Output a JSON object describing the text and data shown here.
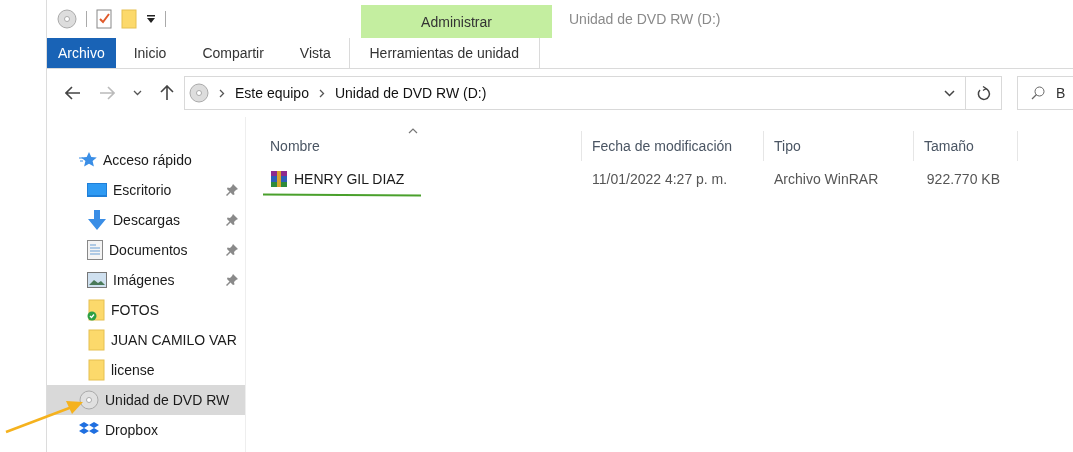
{
  "window": {
    "title": "Unidad de DVD RW (D:)"
  },
  "ribbon": {
    "context_group": "Administrar",
    "tabs": [
      {
        "label": "Archivo",
        "kind": "file"
      },
      {
        "label": "Inicio",
        "kind": "normal"
      },
      {
        "label": "Compartir",
        "kind": "normal"
      },
      {
        "label": "Vista",
        "kind": "normal"
      },
      {
        "label": "Herramientas de unidad",
        "kind": "context"
      }
    ]
  },
  "address_bar": {
    "crumbs": [
      "Este equipo",
      "Unidad de DVD RW (D:)"
    ]
  },
  "search": {
    "placeholder": "B"
  },
  "navigation": [
    {
      "label": "Acceso rápido",
      "kind": "star",
      "pinned": false,
      "selected": false,
      "children": [
        {
          "label": "Escritorio",
          "kind": "desktop",
          "pinned": true,
          "selected": false
        },
        {
          "label": "Descargas",
          "kind": "download",
          "pinned": true,
          "selected": false
        },
        {
          "label": "Documentos",
          "kind": "document",
          "pinned": true,
          "selected": false
        },
        {
          "label": "Imágenes",
          "kind": "images",
          "pinned": true,
          "selected": false
        },
        {
          "label": "FOTOS",
          "kind": "synced",
          "pinned": false,
          "selected": false
        },
        {
          "label": "JUAN CAMILO VAR",
          "kind": "folder",
          "pinned": false,
          "selected": false
        },
        {
          "label": "license",
          "kind": "folder",
          "pinned": false,
          "selected": false
        }
      ]
    },
    {
      "label": "Unidad de DVD RW",
      "kind": "dvd",
      "pinned": false,
      "selected": true
    },
    {
      "label": "Dropbox",
      "kind": "dropbox",
      "pinned": false,
      "selected": false
    }
  ],
  "files": {
    "columns": [
      {
        "label": "Nombre",
        "sorted": true
      },
      {
        "label": "Fecha de modificación",
        "sorted": false
      },
      {
        "label": "Tipo",
        "sorted": false
      },
      {
        "label": "Tamaño",
        "sorted": false
      }
    ],
    "rows": [
      {
        "cells": [
          "HENRY GIL DIAZ",
          "11/01/2022 4:27 p. m.",
          "Archivo WinRAR",
          "922.770 KB"
        ],
        "selected": false
      }
    ]
  }
}
